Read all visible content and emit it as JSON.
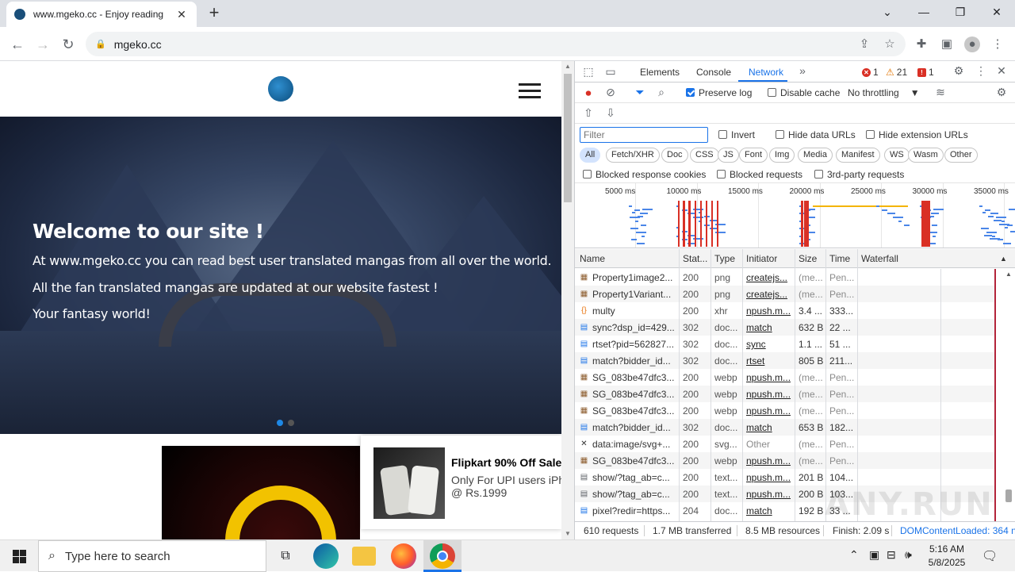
{
  "browser": {
    "tab_title": "www.mgeko.cc - Enjoy reading",
    "url": "mgeko.cc"
  },
  "site": {
    "hero_title": "Welcome to our site !",
    "hero_line1": "At www.mgeko.cc you can read best user translated mangas from all over the world.",
    "hero_line2": "All the fan translated mangas are updated at our website fastest !",
    "hero_line3": "Your fantasy world!",
    "ad_title": "Flipkart 90% Off Sale",
    "ad_line1": "Only For UPI users iPh",
    "ad_line2": "@ Rs.1999"
  },
  "devtools": {
    "tabs": [
      "Elements",
      "Console",
      "Network"
    ],
    "errors": "1",
    "warnings": "21",
    "issues": "1",
    "preserve_log": "Preserve log",
    "disable_cache": "Disable cache",
    "throttling": "No throttling",
    "filter_placeholder": "Filter",
    "invert": "Invert",
    "hide_data_urls": "Hide data URLs",
    "hide_ext_urls": "Hide extension URLs",
    "types": [
      "All",
      "Fetch/XHR",
      "Doc",
      "CSS",
      "JS",
      "Font",
      "Img",
      "Media",
      "Manifest",
      "WS",
      "Wasm",
      "Other"
    ],
    "blocked_cookies": "Blocked response cookies",
    "blocked_requests": "Blocked requests",
    "third_party": "3rd-party requests",
    "timeline_ticks": [
      "5000 ms",
      "10000 ms",
      "15000 ms",
      "20000 ms",
      "25000 ms",
      "30000 ms",
      "35000 ms"
    ],
    "columns": [
      "Name",
      "Stat...",
      "Type",
      "Initiator",
      "Size",
      "Time",
      "Waterfall"
    ],
    "rows": [
      {
        "name": "Property1image2...",
        "status": "200",
        "type": "png",
        "initiator": "createjs...",
        "size": "(me...",
        "time": "Pen...",
        "icon": "image-icon"
      },
      {
        "name": "Property1Variant...",
        "status": "200",
        "type": "png",
        "initiator": "createjs...",
        "size": "(me...",
        "time": "Pen...",
        "icon": "image-icon"
      },
      {
        "name": "multy",
        "status": "200",
        "type": "xhr",
        "initiator": "npush.m...",
        "size": "3.4 ...",
        "time": "333...",
        "icon": "xhr-icon"
      },
      {
        "name": "sync?dsp_id=429...",
        "status": "302",
        "type": "doc...",
        "initiator": "match",
        "size": "632 B",
        "time": "22 ...",
        "icon": "document-icon"
      },
      {
        "name": "rtset?pid=562827...",
        "status": "302",
        "type": "doc...",
        "initiator": "sync",
        "size": "1.1 ...",
        "time": "51 ...",
        "icon": "document-icon"
      },
      {
        "name": "match?bidder_id...",
        "status": "302",
        "type": "doc...",
        "initiator": "rtset",
        "size": "805 B",
        "time": "211...",
        "icon": "document-icon"
      },
      {
        "name": "SG_083be47dfc3...",
        "status": "200",
        "type": "webp",
        "initiator": "npush.m...",
        "size": "(me...",
        "time": "Pen...",
        "icon": "image-icon"
      },
      {
        "name": "SG_083be47dfc3...",
        "status": "200",
        "type": "webp",
        "initiator": "npush.m...",
        "size": "(me...",
        "time": "Pen...",
        "icon": "image-icon"
      },
      {
        "name": "SG_083be47dfc3...",
        "status": "200",
        "type": "webp",
        "initiator": "npush.m...",
        "size": "(me...",
        "time": "Pen...",
        "icon": "image-icon"
      },
      {
        "name": "match?bidder_id...",
        "status": "302",
        "type": "doc...",
        "initiator": "match",
        "size": "653 B",
        "time": "182...",
        "icon": "document-icon"
      },
      {
        "name": "data:image/svg+...",
        "status": "200",
        "type": "svg...",
        "initiator": "Other",
        "size": "(me...",
        "time": "Pen...",
        "icon": "close-icon"
      },
      {
        "name": "SG_083be47dfc3...",
        "status": "200",
        "type": "webp",
        "initiator": "npush.m...",
        "size": "(me...",
        "time": "Pen...",
        "icon": "image-icon"
      },
      {
        "name": "show/?tag_ab=c...",
        "status": "200",
        "type": "text...",
        "initiator": "npush.m...",
        "size": "201 B",
        "time": "104...",
        "icon": "script-icon"
      },
      {
        "name": "show/?tag_ab=c...",
        "status": "200",
        "type": "text...",
        "initiator": "npush.m...",
        "size": "200 B",
        "time": "103...",
        "icon": "script-icon"
      },
      {
        "name": "pixel?redir=https...",
        "status": "204",
        "type": "doc...",
        "initiator": "match",
        "size": "192 B",
        "time": "33 ...",
        "icon": "document-icon"
      }
    ],
    "status_requests": "610 requests",
    "status_transferred": "1.7 MB transferred",
    "status_resources": "8.5 MB resources",
    "status_finish": "Finish: 2.09 s",
    "status_dcl": "DOMContentLoaded: 364 n"
  },
  "taskbar": {
    "search_placeholder": "Type here to search",
    "time": "5:16 AM",
    "date": "5/8/2025"
  },
  "watermark": "ANY.RUN"
}
